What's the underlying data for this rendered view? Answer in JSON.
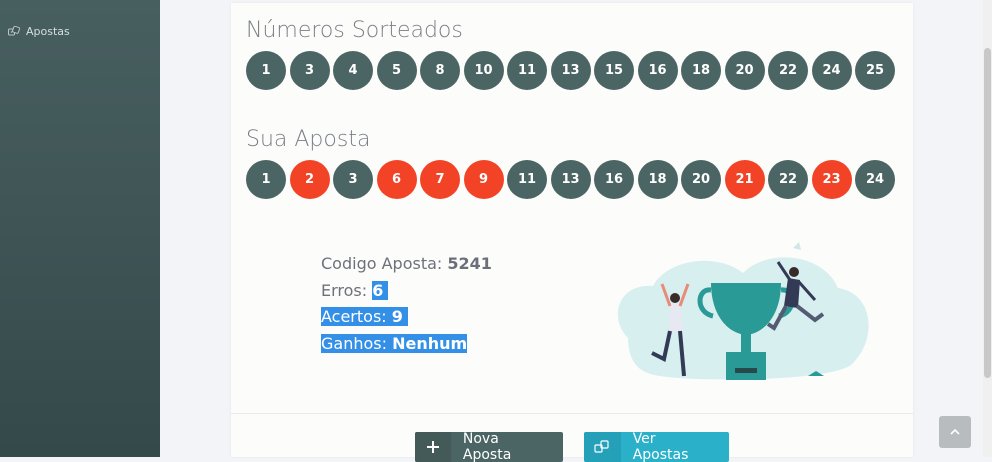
{
  "sidebar": {
    "items": [
      {
        "label": "Apostas",
        "icon": "dice-icon"
      }
    ]
  },
  "drawn": {
    "title": "Números Sorteados",
    "numbers": [
      "1",
      "3",
      "4",
      "5",
      "8",
      "10",
      "11",
      "13",
      "15",
      "16",
      "18",
      "20",
      "22",
      "24",
      "25"
    ]
  },
  "bet": {
    "title": "Sua Aposta",
    "numbers": [
      {
        "n": "1",
        "hit": false
      },
      {
        "n": "2",
        "hit": true
      },
      {
        "n": "3",
        "hit": false
      },
      {
        "n": "6",
        "hit": true
      },
      {
        "n": "7",
        "hit": true
      },
      {
        "n": "9",
        "hit": true
      },
      {
        "n": "11",
        "hit": false
      },
      {
        "n": "13",
        "hit": false
      },
      {
        "n": "16",
        "hit": false
      },
      {
        "n": "18",
        "hit": false
      },
      {
        "n": "20",
        "hit": false
      },
      {
        "n": "21",
        "hit": true
      },
      {
        "n": "22",
        "hit": false
      },
      {
        "n": "23",
        "hit": true
      },
      {
        "n": "24",
        "hit": false
      }
    ]
  },
  "result": {
    "code_label": "Codigo Aposta: ",
    "code_value": "5241",
    "errors_label": "Erros: ",
    "errors_value": "6",
    "hits_label": "Acertos: ",
    "hits_value": "9",
    "gains_label": "Ganhos: ",
    "gains_value": "Nenhum"
  },
  "buttons": {
    "new_bet": "Nova Aposta",
    "view_bets": "Ver Apostas"
  },
  "colors": {
    "ball_default": "#4b6564",
    "ball_miss": "#f24326",
    "accent": "#2ab0c9",
    "sidebar": "#3f5556"
  }
}
